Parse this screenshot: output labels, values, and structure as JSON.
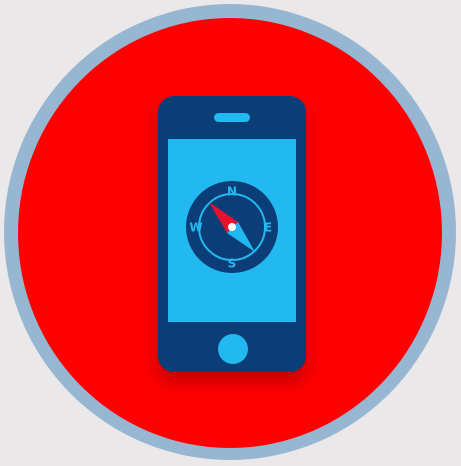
{
  "icon": {
    "name": "mobile-compass-icon",
    "colors": {
      "background": "#ebe8ea",
      "ring": "#97b6d2",
      "circle": "#fe0000",
      "phone_body": "#0b3e77",
      "screen": "#22b8f0",
      "needle_north": "#e8112d",
      "needle_south": "#22b8f0"
    },
    "compass_directions": {
      "north": "N",
      "east": "E",
      "south": "S",
      "west": "W"
    }
  }
}
